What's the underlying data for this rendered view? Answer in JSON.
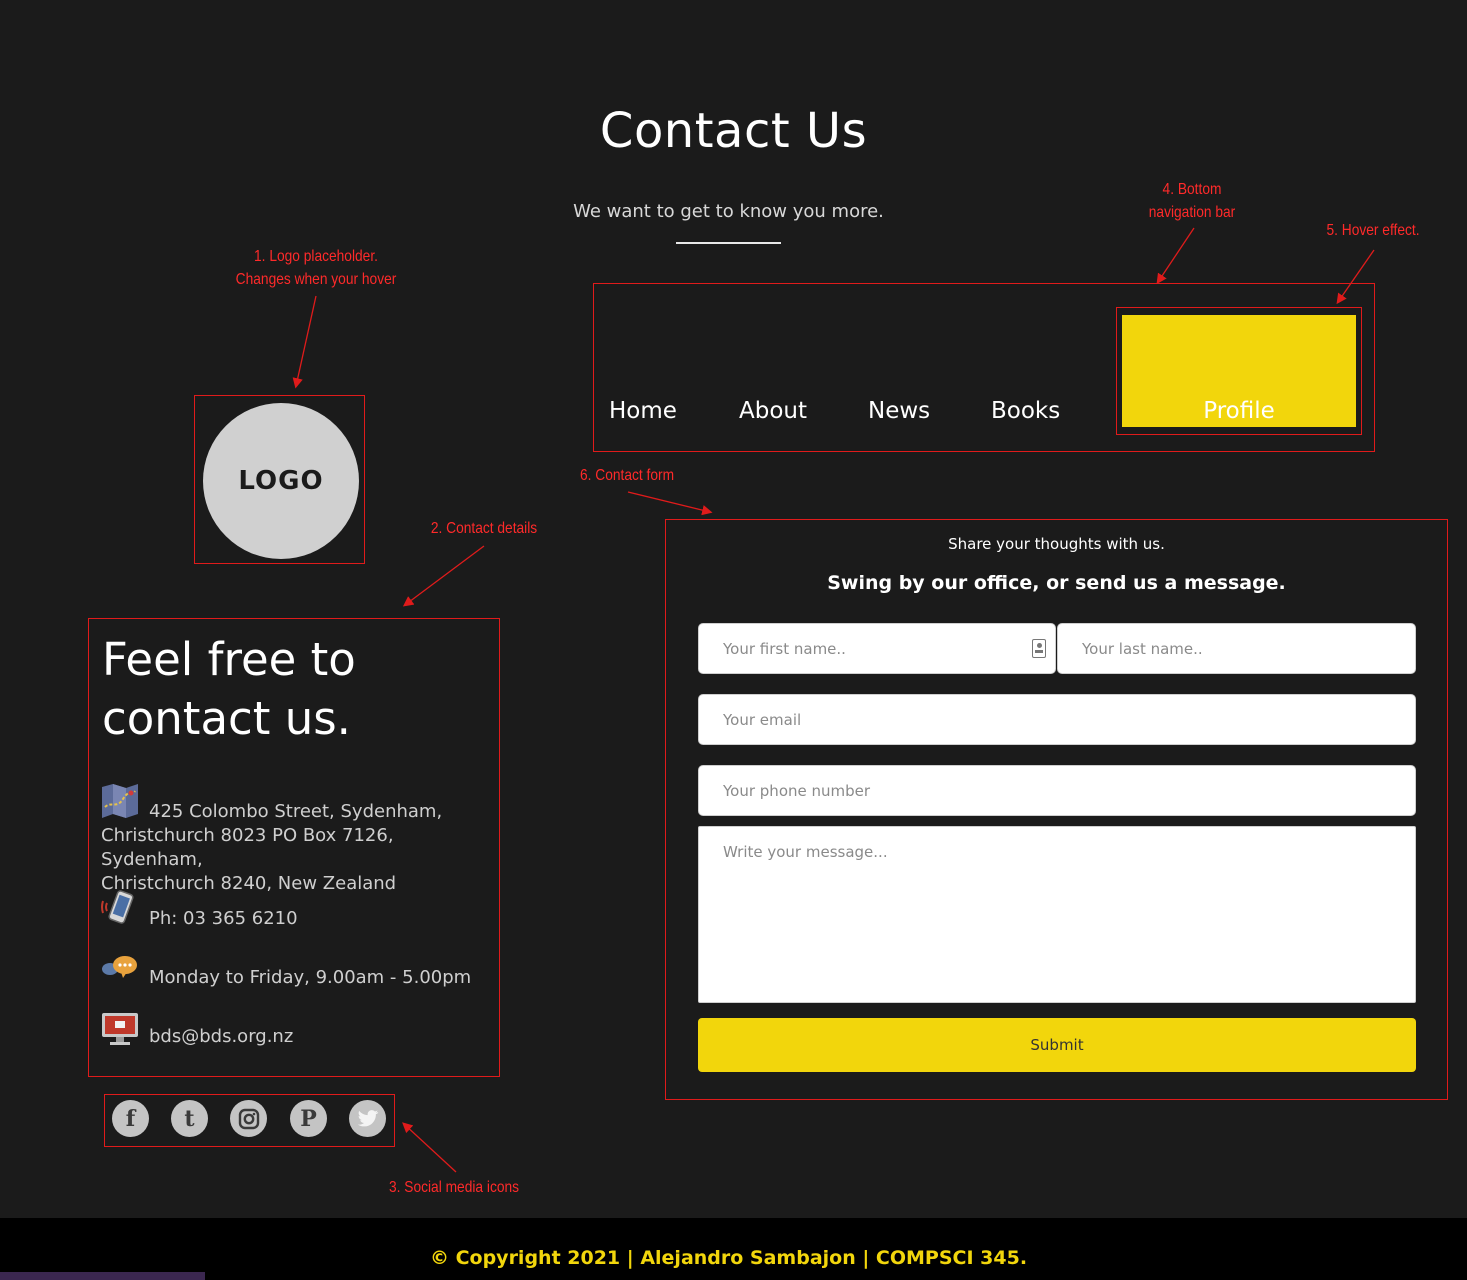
{
  "header": {
    "title": "Contact Us",
    "subtitle": "We want to get to know you more."
  },
  "annotations": {
    "logo_line1": "1. Logo placeholder.",
    "logo_line2": "Changes when your hover",
    "contact_details": "2. Contact details",
    "social_icons": "3. Social media icons",
    "nav_line1": "4. Bottom",
    "nav_line2": "navigation bar",
    "hover_effect": "5. Hover effect.",
    "contact_form": "6. Contact form"
  },
  "logo": {
    "text": "LOGO"
  },
  "nav": {
    "items": [
      {
        "label": "Home"
      },
      {
        "label": "About"
      },
      {
        "label": "News"
      },
      {
        "label": "Books"
      },
      {
        "label": "Profile",
        "hovered": true
      }
    ],
    "hover_color": "#f2d60c"
  },
  "contact_details": {
    "heading_line1": "Feel free to",
    "heading_line2": "contact us.",
    "address_line1": "425 Colombo Street, Sydenham,",
    "address_line2": "Christchurch 8023 PO Box 7126, Sydenham,",
    "address_line3": "Christchurch 8240, New Zealand",
    "phone": "Ph: 03 365 6210",
    "hours": "Monday to Friday, 9.00am - 5.00pm",
    "email": "bds@bds.org.nz",
    "icons": [
      "map-icon",
      "phone-icon",
      "chat-icon",
      "computer-icon"
    ]
  },
  "social": {
    "icons": [
      {
        "name": "facebook-icon",
        "glyph": "f"
      },
      {
        "name": "tumblr-icon",
        "glyph": "t"
      },
      {
        "name": "instagram-icon",
        "glyph": ""
      },
      {
        "name": "pinterest-icon",
        "glyph": "P"
      },
      {
        "name": "twitter-icon",
        "glyph": ""
      }
    ]
  },
  "form": {
    "share_text": "Share your thoughts with us.",
    "swing_text": "Swing by our office, or send us a message.",
    "first_name_placeholder": "Your first name..",
    "last_name_placeholder": "Your last name..",
    "email_placeholder": "Your email",
    "phone_placeholder": "Your phone number",
    "message_placeholder": "Write your message...",
    "submit_label": "Submit",
    "accent": "#f2d60c"
  },
  "footer": {
    "copyright": "© Copyright 2021 | Alejandro Sambajon | COMPSCI 345."
  }
}
